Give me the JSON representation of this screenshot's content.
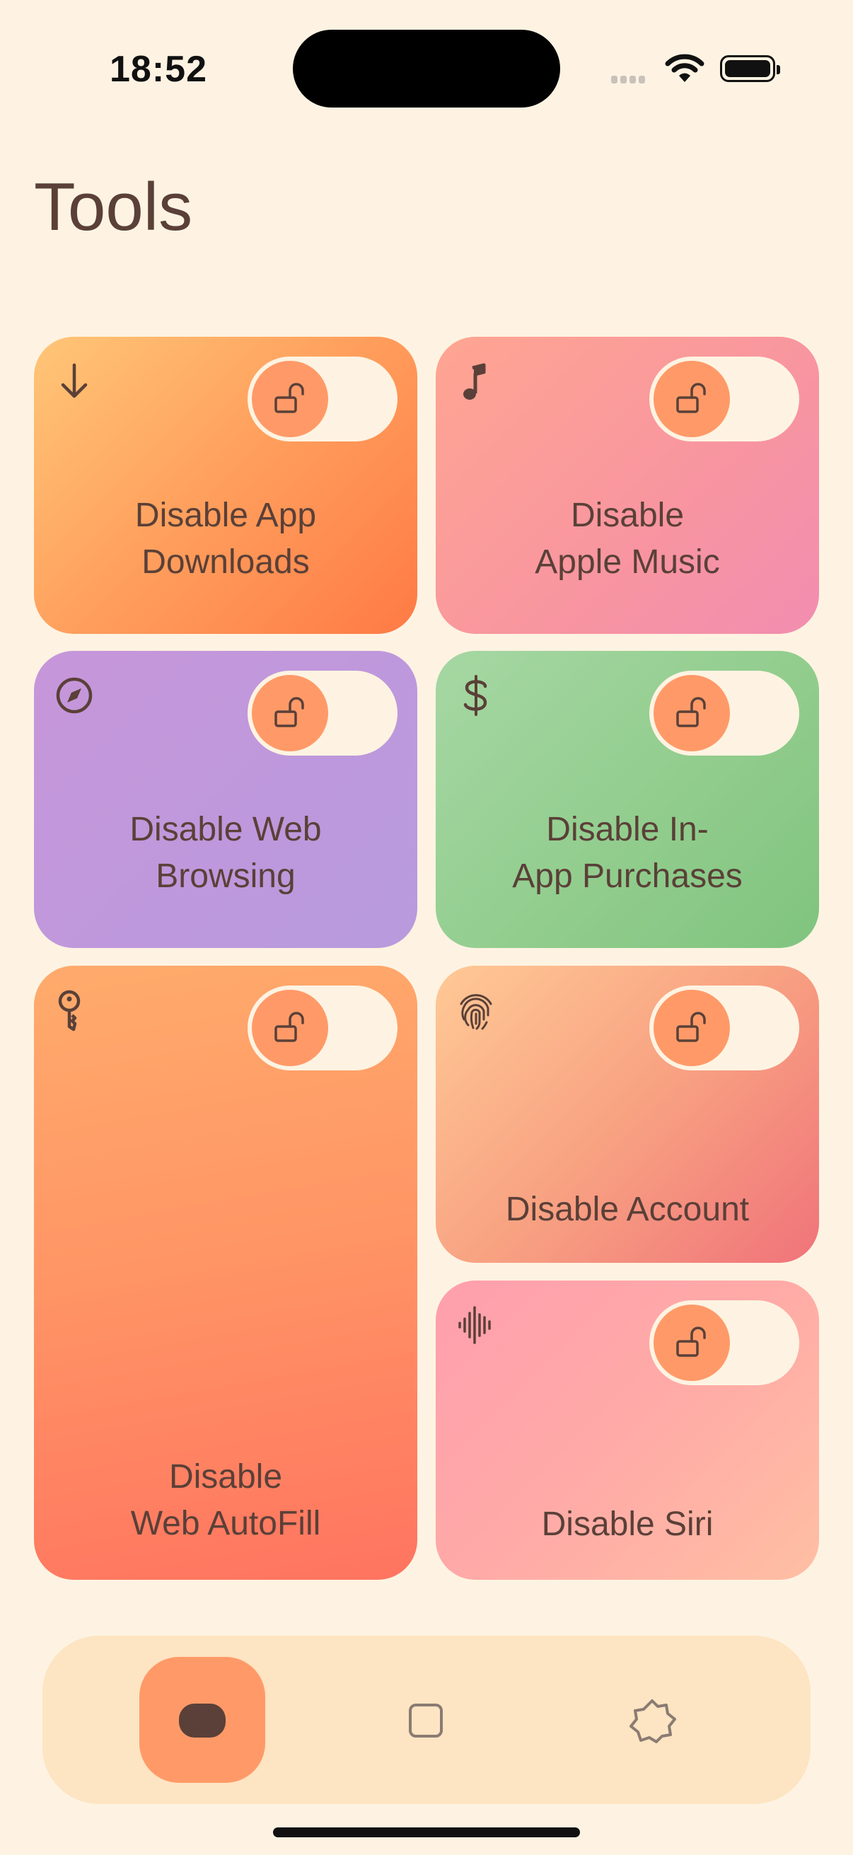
{
  "status_bar": {
    "time": "18:52"
  },
  "page": {
    "title": "Tools"
  },
  "tools": [
    {
      "label": "Disable App\nDownloads",
      "icon": "download-arrow-icon",
      "enabled": false
    },
    {
      "label": "Disable\nApple Music",
      "icon": "music-note-icon",
      "enabled": false
    },
    {
      "label": "Disable Web\nBrowsing",
      "icon": "compass-icon",
      "enabled": false
    },
    {
      "label": "Disable In-\nApp Purchases",
      "icon": "dollar-icon",
      "enabled": false
    },
    {
      "label": "Disable\nWeb AutoFill",
      "icon": "key-icon",
      "enabled": false
    },
    {
      "label": "Disable Account",
      "icon": "fingerprint-icon",
      "enabled": false
    },
    {
      "label": "Disable Siri",
      "icon": "waveform-icon",
      "enabled": false
    }
  ],
  "tab_bar": {
    "tabs": [
      {
        "icon": "pill-icon",
        "selected": true
      },
      {
        "icon": "square-icon",
        "selected": false
      },
      {
        "icon": "gear-icon",
        "selected": false
      }
    ]
  },
  "colors": {
    "background": "#FEF3E2",
    "accent": "#FF9A68",
    "text": "#5A4038"
  }
}
